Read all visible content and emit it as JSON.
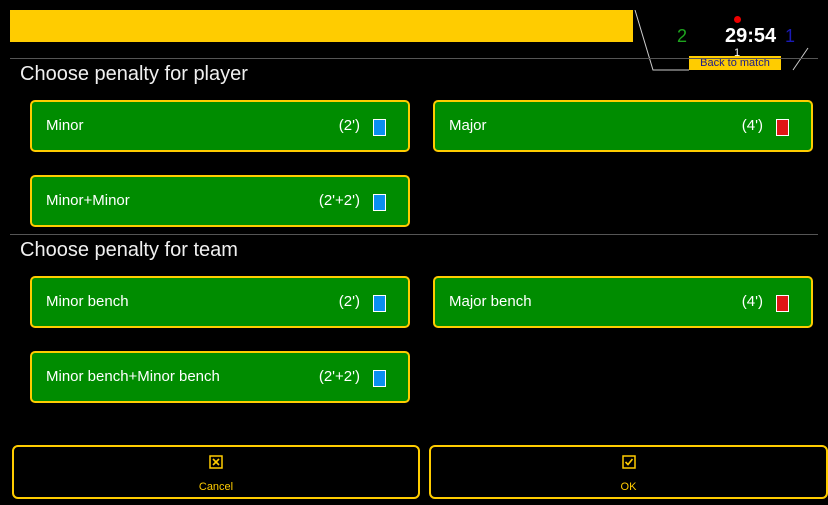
{
  "scoreboard": {
    "home_score": "2",
    "clock": "29:54",
    "period": "1",
    "away_score": "1",
    "back_label": "Back to match",
    "home_color": "#1ea51e",
    "away_color": "#1a1ab5",
    "accent": "#ffcc00"
  },
  "player_section": {
    "title": "Choose penalty for player",
    "buttons": [
      {
        "label": "Minor",
        "time": "(2')",
        "card": "blue"
      },
      {
        "label": "Major",
        "time": "(4')",
        "card": "red"
      },
      {
        "label": "Minor+Minor",
        "time": "(2'+2')",
        "card": "blue"
      }
    ]
  },
  "team_section": {
    "title": "Choose penalty for team",
    "buttons": [
      {
        "label": "Minor bench",
        "time": "(2')",
        "card": "blue"
      },
      {
        "label": "Major bench",
        "time": "(4')",
        "card": "red"
      },
      {
        "label": "Minor bench+Minor bench",
        "time": "(2'+2')",
        "card": "blue"
      }
    ]
  },
  "actions": {
    "cancel": {
      "label": "Cancel",
      "icon": "x-box-icon"
    },
    "ok": {
      "label": "OK",
      "icon": "checkbox-icon"
    }
  }
}
